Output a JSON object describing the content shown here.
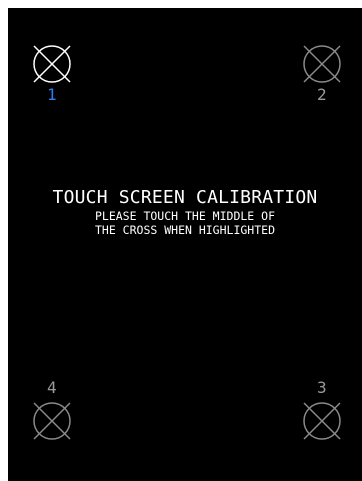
{
  "calibration": {
    "title": "TOUCH SCREEN CALIBRATION",
    "instruction_line1": "PLEASE TOUCH THE MIDDLE OF",
    "instruction_line2": "THE CROSS WHEN HIGHLIGHTED"
  },
  "targets": [
    {
      "number": "1",
      "state": "active",
      "icon": "crosshair-icon"
    },
    {
      "number": "2",
      "state": "inactive",
      "icon": "crosshair-icon"
    },
    {
      "number": "3",
      "state": "inactive",
      "icon": "crosshair-icon"
    },
    {
      "number": "4",
      "state": "inactive",
      "icon": "crosshair-icon"
    }
  ],
  "colors": {
    "background": "#000000",
    "text": "#ffffff",
    "active_target": "#ffffff",
    "inactive_target": "#8a8a8a",
    "active_number": "#2f7df6",
    "inactive_number": "#9a9a9a"
  }
}
